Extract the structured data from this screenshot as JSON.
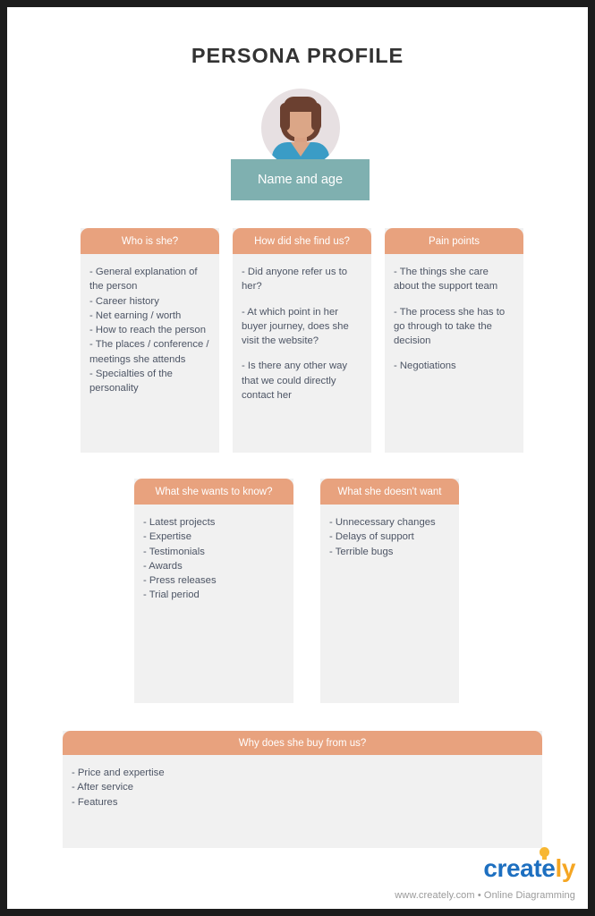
{
  "page": {
    "title": "PERSONA PROFILE",
    "accent_header_color": "#E8A27E",
    "card_body_color": "#F1F1F1",
    "name_bar_color": "#7FB0B0",
    "body_text_color": "#4D5565"
  },
  "avatar": {
    "icon_name": "female-persona-avatar",
    "hair_color": "#6B4030",
    "skin_color": "#DBA687",
    "shirt_color": "#3A9CC6",
    "circle_color": "#E7E0E2"
  },
  "name_bar": {
    "label": "Name and age"
  },
  "cards": [
    {
      "id": "who",
      "title": "Who is she?",
      "lines": [
        "- General explanation of the person",
        "- Career history",
        "- Net earning / worth",
        "- How to reach the person",
        "- The places / conference / meetings she attends",
        "- Specialties of the personality"
      ]
    },
    {
      "id": "find",
      "title": "How did she find us?",
      "lines": [
        "- Did anyone refer us to her?",
        "",
        "- At which point in her buyer journey, does she visit the website?",
        "",
        "- Is there any other way that we could directly contact her"
      ]
    },
    {
      "id": "pain",
      "title": "Pain points",
      "lines": [
        "- The things she care about the support team",
        "",
        "- The process she has to go through to take the decision",
        "",
        "- Negotiations"
      ]
    },
    {
      "id": "want",
      "title": "What she wants to know?",
      "lines": [
        "- Latest projects",
        "- Expertise",
        "- Testimonials",
        "- Awards",
        "- Press releases",
        "- Trial period"
      ]
    },
    {
      "id": "avoid",
      "title": "What she doesn't want",
      "lines": [
        "- Unnecessary changes",
        "- Delays of support",
        "- Terrible bugs"
      ]
    },
    {
      "id": "buy",
      "title": "Why does she buy from us?",
      "lines": [
        "- Price and expertise",
        "- After service",
        "- Features"
      ]
    }
  ],
  "branding": {
    "logo_part_one": "create",
    "logo_part_two": "ly",
    "logo_icon": "lightbulb-icon",
    "logo_color_primary": "#1D6FC0",
    "logo_color_secondary": "#F5A623",
    "footer": "www.creately.com • Online Diagramming"
  }
}
